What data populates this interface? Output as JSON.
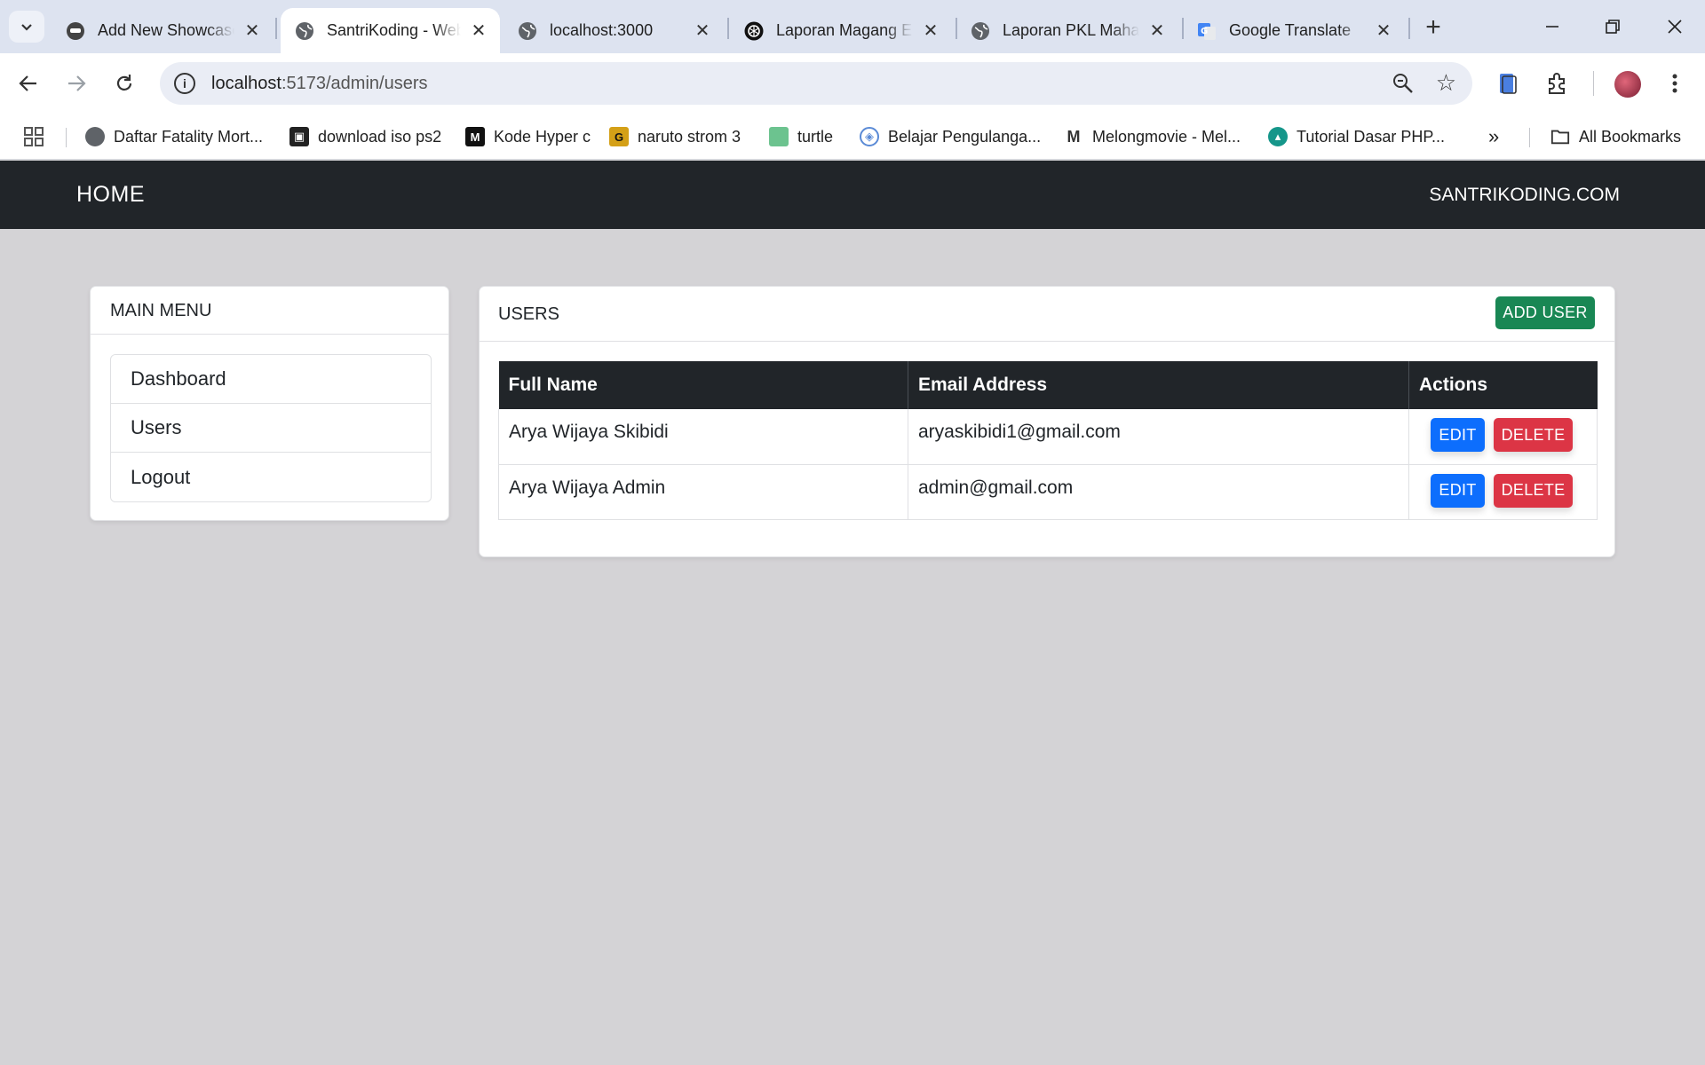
{
  "browser": {
    "tabs": [
      {
        "title": "Add New Showcase",
        "icon": "showcase-icon",
        "active": false
      },
      {
        "title": "SantriKoding - Web",
        "icon": "globe-icon",
        "active": true
      },
      {
        "title": "localhost:3000",
        "icon": "globe-icon",
        "active": false
      },
      {
        "title": "Laporan Magang E",
        "icon": "openai-icon",
        "active": false
      },
      {
        "title": "Laporan PKL Maha",
        "icon": "globe-icon",
        "active": false
      },
      {
        "title": "Google Translate",
        "icon": "google-translate-icon",
        "active": false
      }
    ],
    "url_host": "localhost",
    "url_path": ":5173/admin/users",
    "bookmarks": [
      {
        "label": "Daftar Fatality Mort...",
        "icon": "globe-icon"
      },
      {
        "label": "download iso ps2",
        "icon": "ps2-icon"
      },
      {
        "label": "Kode Hyper c",
        "icon": "m-logo-icon"
      },
      {
        "label": "naruto  strom 3",
        "icon": "g-logo-icon"
      },
      {
        "label": "turtle",
        "icon": "cube-icon"
      },
      {
        "label": "Belajar Pengulanga...",
        "icon": "emblem-icon"
      },
      {
        "label": "Melongmovie - Mel...",
        "icon": "m-outline-icon"
      },
      {
        "label": "Tutorial Dasar PHP...",
        "icon": "teal-logo-icon"
      }
    ],
    "all_bookmarks": "All Bookmarks"
  },
  "navbar": {
    "home": "HOME",
    "site": "SANTRIKODING.COM"
  },
  "menu": {
    "title": "MAIN MENU",
    "items": [
      "Dashboard",
      "Users",
      "Logout"
    ]
  },
  "users": {
    "title": "USERS",
    "add_label": "ADD USER",
    "columns": [
      "Full Name",
      "Email Address",
      "Actions"
    ],
    "rows": [
      {
        "name": "Arya Wijaya Skibidi",
        "email": "aryaskibidi1@gmail.com"
      },
      {
        "name": "Arya Wijaya Admin",
        "email": "admin@gmail.com"
      }
    ],
    "edit_label": "EDIT",
    "delete_label": "DELETE"
  },
  "colors": {
    "navbar": "#212529",
    "add_button": "#198754",
    "edit_button": "#0d6efd",
    "delete_button": "#dc3545",
    "page_background": "#d4d3d6"
  }
}
